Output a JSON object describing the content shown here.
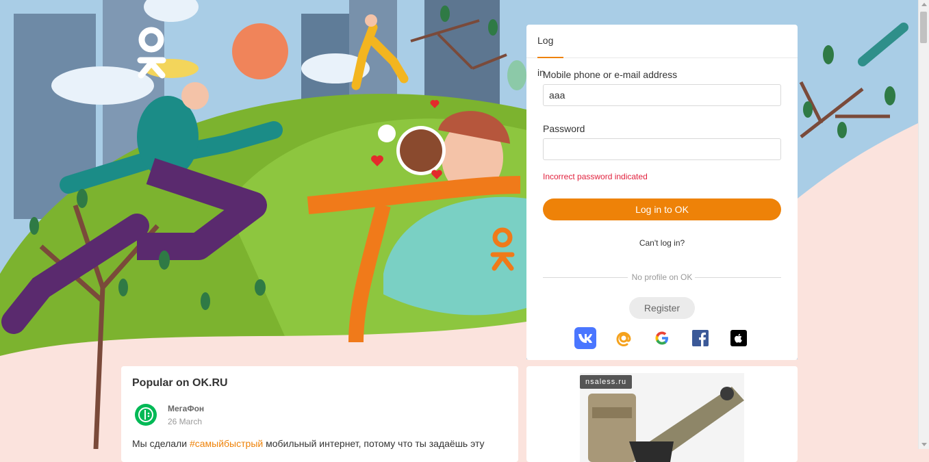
{
  "brand": {
    "logo_icon": "ok-logo-icon",
    "accent": "#ee8208"
  },
  "login": {
    "tab_label": "Log in",
    "login_label": "Mobile phone or e-mail address",
    "login_value": "aaa",
    "password_label": "Password",
    "password_value": "",
    "error": "Incorrect password indicated",
    "submit_label": "Log in to OK",
    "cant_login": "Can't log in?",
    "divider_text": "No profile on OK",
    "register_label": "Register",
    "social_icons": [
      "vk-icon",
      "mail-ru-icon",
      "google-icon",
      "facebook-icon",
      "apple-icon"
    ]
  },
  "popular": {
    "title": "Popular on OK.RU",
    "author": "МегаФон",
    "date": "26 March",
    "text_before": "Мы сделали ",
    "hashtag": "#самыйбыстрый",
    "text_after": " мобильный интернет, потому что ты задаёшь эту"
  },
  "ad": {
    "badge": "nsaless.ru"
  }
}
